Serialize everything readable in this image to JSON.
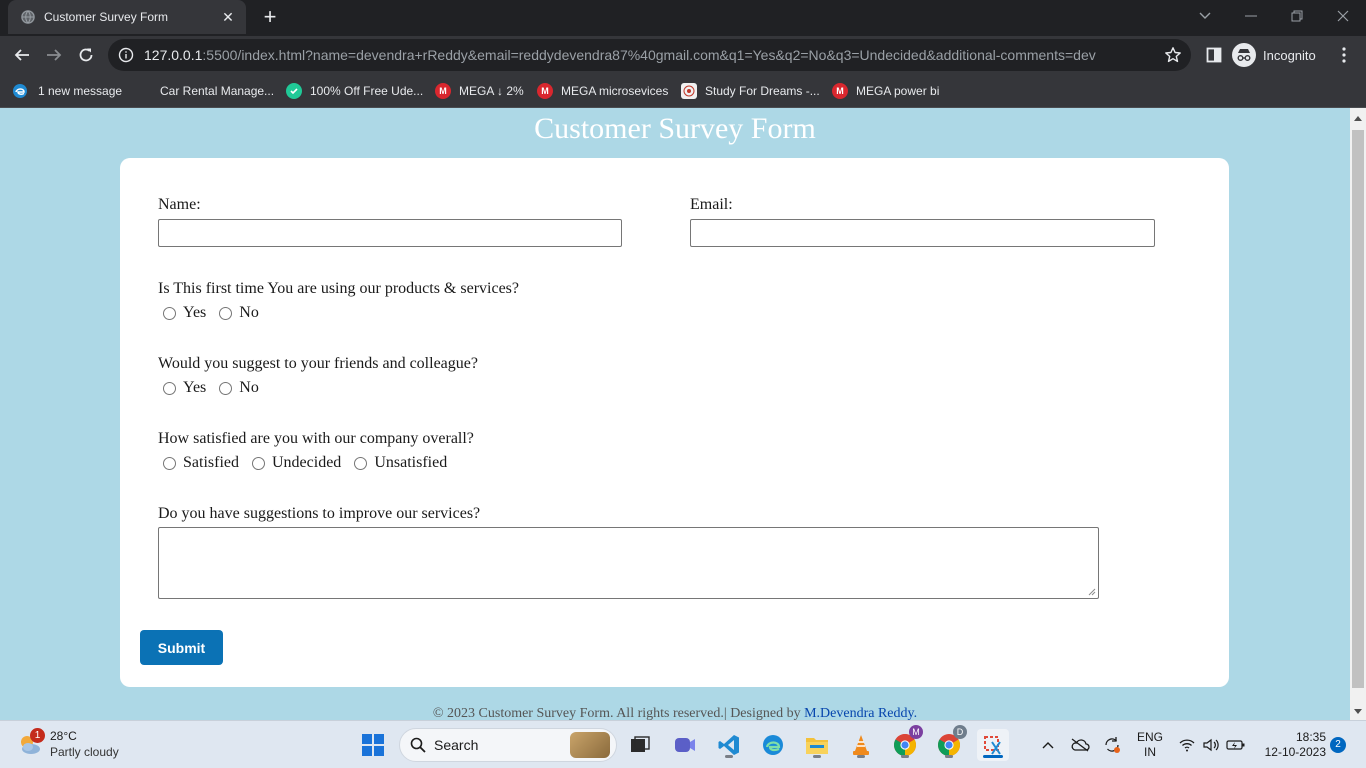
{
  "browser": {
    "tab_title": "Customer Survey Form",
    "tab_close": "✕",
    "new_tab": "+",
    "url_host": "127.0.0.1",
    "url_rest": ":5500/index.html?name=devendra+rReddy&email=reddydevendra87%40gmail.com&q1=Yes&q2=No&q3=Undecided&additional-comments=dev",
    "incognito_label": "Incognito",
    "bookmarks": [
      {
        "label": "1 new message",
        "icon": "edge-icon"
      },
      {
        "label": "Car Rental Manage...",
        "icon": "folder-icon"
      },
      {
        "label": "100% Off Free Ude...",
        "icon": "coupon-icon"
      },
      {
        "label": "MEGA ↓ 2%",
        "icon": "mega-icon"
      },
      {
        "label": "MEGA microsevices",
        "icon": "mega-icon"
      },
      {
        "label": "Study For Dreams -...",
        "icon": "site-icon"
      },
      {
        "label": "MEGA power bi",
        "icon": "mega-icon"
      }
    ],
    "mega_letter": "M"
  },
  "page": {
    "title": "Customer Survey Form",
    "name_label": "Name:",
    "email_label": "Email:",
    "name_value": "",
    "email_value": "",
    "q1": {
      "label": "Is This first time You are using our products & services?",
      "options": [
        "Yes",
        "No"
      ]
    },
    "q2": {
      "label": "Would you suggest to your friends and colleague?",
      "options": [
        "Yes",
        "No"
      ]
    },
    "q3": {
      "label": "How satisfied are you with our company overall?",
      "options": [
        "Satisfied",
        "Undecided",
        "Unsatisfied"
      ]
    },
    "q4": {
      "label": "Do you have suggestions to improve our services?"
    },
    "submit_label": "Submit",
    "footer_text": "© 2023 Customer Survey Form. All rights reserved.| Designed by ",
    "footer_link": "M.Devendra Reddy."
  },
  "taskbar": {
    "weather_temp": "28°C",
    "weather_desc": "Partly cloudy",
    "weather_badge": "1",
    "search_label": "Search",
    "chrome_profile_m": "M",
    "chrome_profile_d": "D",
    "lang_top": "ENG",
    "lang_bottom": "IN",
    "time": "18:35",
    "date": "12-10-2023",
    "notification_count": "2"
  },
  "colors": {
    "page_bg": "#add8e6",
    "submit_bg": "#0b72b5",
    "link": "#0645ad",
    "chrome_dark": "#202124",
    "chrome_toolbar": "#35363a"
  }
}
